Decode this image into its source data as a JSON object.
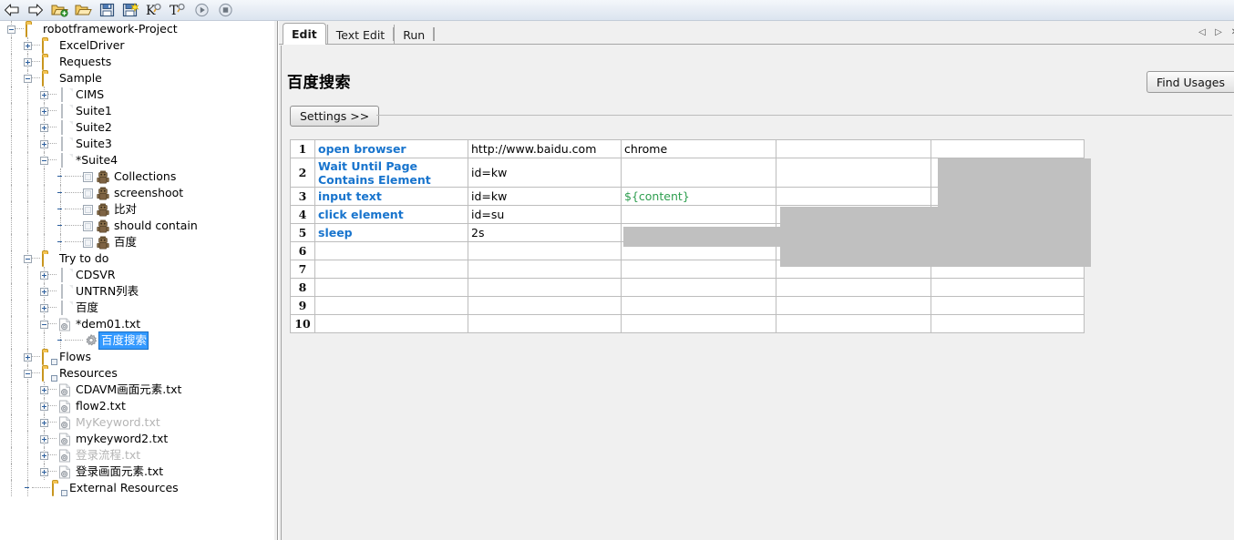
{
  "toolbar": {
    "buttons": [
      {
        "name": "back-arrow-icon",
        "glyph": "⇦",
        "title": "Back"
      },
      {
        "name": "forward-arrow-icon",
        "glyph": "⇨",
        "title": "Forward"
      },
      {
        "name": "open-project-icon",
        "glyph": "",
        "title": "Open Directory"
      },
      {
        "name": "open-folder-icon",
        "glyph": "",
        "title": "Open"
      },
      {
        "name": "save-icon",
        "glyph": "",
        "title": "Save"
      },
      {
        "name": "save-all-icon",
        "glyph": "",
        "title": "Save All"
      },
      {
        "name": "search-keyword-icon",
        "glyph": "K",
        "title": "Search Keywords"
      },
      {
        "name": "search-tests-icon",
        "glyph": "T",
        "title": "Search Tests"
      },
      {
        "name": "run-icon",
        "glyph": "▶",
        "title": "Run"
      },
      {
        "name": "stop-icon",
        "glyph": "■",
        "title": "Stop"
      }
    ]
  },
  "sidebar": {
    "tree": [
      {
        "depth": 0,
        "label": "robotframework-Project",
        "toggle": "minus",
        "icon": "folder",
        "dim": false,
        "selected": false
      },
      {
        "depth": 1,
        "label": "ExcelDriver",
        "toggle": "plus",
        "icon": "folder",
        "dim": false,
        "selected": false
      },
      {
        "depth": 1,
        "label": "Requests",
        "toggle": "plus",
        "icon": "folder",
        "dim": false,
        "selected": false
      },
      {
        "depth": 1,
        "label": "Sample",
        "toggle": "minus",
        "icon": "folder",
        "dim": false,
        "selected": false
      },
      {
        "depth": 2,
        "label": "CIMS",
        "toggle": "plus",
        "icon": "doc",
        "dim": false,
        "selected": false
      },
      {
        "depth": 2,
        "label": "Suite1",
        "toggle": "plus",
        "icon": "doc",
        "dim": false,
        "selected": false
      },
      {
        "depth": 2,
        "label": "Suite2",
        "toggle": "plus",
        "icon": "doc",
        "dim": false,
        "selected": false
      },
      {
        "depth": 2,
        "label": "Suite3",
        "toggle": "plus",
        "icon": "doc",
        "dim": false,
        "selected": false
      },
      {
        "depth": 2,
        "label": "*Suite4",
        "toggle": "minus",
        "icon": "doc",
        "dim": false,
        "selected": false
      },
      {
        "depth": 3,
        "label": "Collections",
        "toggle": "none",
        "icon": "robot",
        "check": true,
        "dim": false,
        "selected": false
      },
      {
        "depth": 3,
        "label": "screenshoot",
        "toggle": "none",
        "icon": "robot",
        "check": true,
        "dim": false,
        "selected": false
      },
      {
        "depth": 3,
        "label": "比对",
        "toggle": "none",
        "icon": "robot",
        "check": true,
        "dim": false,
        "selected": false
      },
      {
        "depth": 3,
        "label": "should contain",
        "toggle": "none",
        "icon": "robot",
        "check": true,
        "dim": false,
        "selected": false
      },
      {
        "depth": 3,
        "label": "百度",
        "toggle": "none",
        "icon": "robot",
        "check": true,
        "dim": false,
        "selected": false
      },
      {
        "depth": 1,
        "label": "Try to do",
        "toggle": "minus",
        "icon": "folder",
        "dim": false,
        "selected": false
      },
      {
        "depth": 2,
        "label": "CDSVR",
        "toggle": "plus",
        "icon": "doc",
        "dim": false,
        "selected": false
      },
      {
        "depth": 2,
        "label": "UNTRN列表",
        "toggle": "plus",
        "icon": "doc",
        "dim": false,
        "selected": false
      },
      {
        "depth": 2,
        "label": "百度",
        "toggle": "plus",
        "icon": "doc",
        "dim": false,
        "selected": false
      },
      {
        "depth": 2,
        "label": "*dem01.txt",
        "toggle": "minus",
        "icon": "docgear",
        "dim": false,
        "selected": false
      },
      {
        "depth": 3,
        "label": "百度搜索",
        "toggle": "none",
        "icon": "gear",
        "dim": false,
        "selected": true
      },
      {
        "depth": 1,
        "label": "Flows",
        "toggle": "plus",
        "icon": "reslink",
        "dim": false,
        "selected": false
      },
      {
        "depth": 1,
        "label": "Resources",
        "toggle": "minus",
        "icon": "reslink",
        "dim": false,
        "selected": false
      },
      {
        "depth": 2,
        "label": "CDAVM画面元素.txt",
        "toggle": "plus",
        "icon": "docgear",
        "dim": false,
        "selected": false
      },
      {
        "depth": 2,
        "label": "flow2.txt",
        "toggle": "plus",
        "icon": "docgear",
        "dim": false,
        "selected": false
      },
      {
        "depth": 2,
        "label": "MyKeyword.txt",
        "toggle": "plus",
        "icon": "docgear",
        "dim": true,
        "selected": false
      },
      {
        "depth": 2,
        "label": "mykeyword2.txt",
        "toggle": "plus",
        "icon": "docgear",
        "dim": false,
        "selected": false
      },
      {
        "depth": 2,
        "label": "登录流程.txt",
        "toggle": "plus",
        "icon": "docgear",
        "dim": true,
        "selected": false
      },
      {
        "depth": 2,
        "label": "登录画面元素.txt",
        "toggle": "plus",
        "icon": "docgear",
        "dim": false,
        "selected": false
      },
      {
        "depth": 1,
        "label": "External Resources",
        "toggle": "none",
        "icon": "reslink",
        "dim": false,
        "selected": false
      }
    ]
  },
  "editor": {
    "tabs": [
      {
        "label": "Edit",
        "active": true
      },
      {
        "label": "Text Edit",
        "active": false
      },
      {
        "label": "Run",
        "active": false
      }
    ],
    "nav": {
      "prev": "◁",
      "next": "▷",
      "close": "✕"
    },
    "title": "百度搜索",
    "find_usages_label": "Find Usages",
    "settings_label": "Settings >>",
    "grid": {
      "row_numbers": [
        "1",
        "2",
        "3",
        "4",
        "5",
        "6",
        "7",
        "8",
        "9",
        "10"
      ],
      "rows": [
        {
          "num": "1",
          "cells": [
            "open browser",
            "http://www.baidu.com",
            "chrome",
            "",
            ""
          ]
        },
        {
          "num": "2",
          "cells": [
            "Wait Until Page Contains Element",
            "id=kw",
            "",
            "",
            ""
          ]
        },
        {
          "num": "3",
          "cells": [
            "input text",
            "id=kw",
            "${content}",
            "",
            ""
          ]
        },
        {
          "num": "4",
          "cells": [
            "click element",
            "id=su",
            "",
            "",
            ""
          ]
        },
        {
          "num": "5",
          "cells": [
            "sleep",
            "2s",
            "",
            "",
            ""
          ]
        },
        {
          "num": "6",
          "cells": [
            "",
            "",
            "",
            "",
            ""
          ]
        },
        {
          "num": "7",
          "cells": [
            "",
            "",
            "",
            "",
            ""
          ]
        },
        {
          "num": "8",
          "cells": [
            "",
            "",
            "",
            "",
            ""
          ]
        },
        {
          "num": "9",
          "cells": [
            "",
            "",
            "",
            "",
            ""
          ]
        },
        {
          "num": "10",
          "cells": [
            "",
            "",
            "",
            "",
            ""
          ]
        }
      ]
    }
  },
  "colors": {
    "keyword_blue": "#1874cd",
    "variable_green": "#2e9e4f",
    "selection_gray": "#c0c0c0",
    "tree_selection_blue": "#3399ff"
  }
}
